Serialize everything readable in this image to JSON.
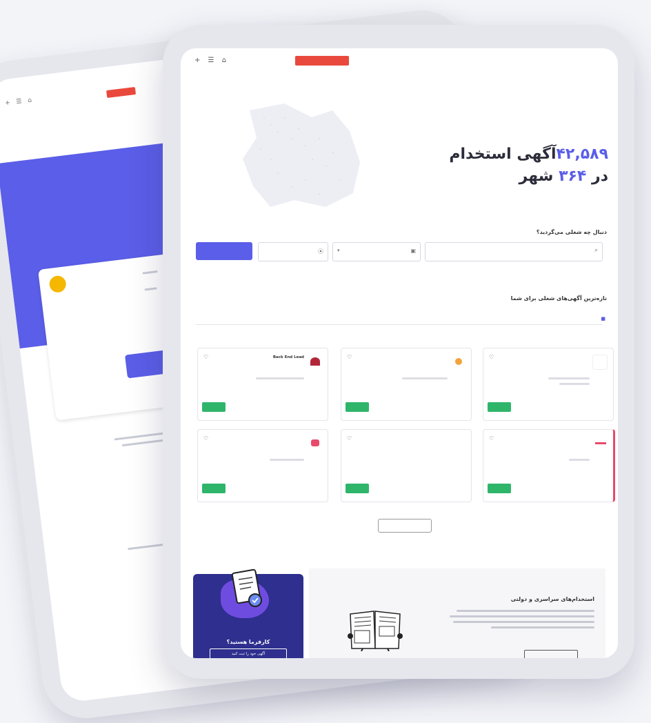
{
  "back_screen": {
    "badge": "",
    "icons": "+ ☰ ⌂",
    "link": "",
    "button": "",
    "side_text_1": "",
    "side_text_2": ""
  },
  "front_screen": {
    "logo": "",
    "nav": {
      "icons": "+ ☰ ⌂",
      "badge": "",
      "items": [
        "",
        "",
        "",
        "",
        "",
        ""
      ]
    },
    "hero": {
      "count": "۴۲,۵۸۹",
      "count_label": "آگهی استخدام",
      "city_prefix": "در",
      "city_count": "۳۶۴",
      "city_label": "شهر"
    },
    "search": {
      "question": "دنبال چه شغلی می‌گردید؟",
      "keyword_placeholder": "",
      "category_placeholder": "",
      "city_placeholder": "",
      "button": ""
    },
    "latest": {
      "title": "تازه‌ترین آگهی‌های شغلی برای شما",
      "suggest_tab": "",
      "suggest_sub": ""
    },
    "jobs": [
      {
        "title": "",
        "company": "",
        "location": "",
        "send": "",
        "logo_color": "#ffffff"
      },
      {
        "title": "",
        "company": "",
        "location": "",
        "send": "",
        "logo_color": "#f2a33a"
      },
      {
        "title": "Back End Lead",
        "company": "",
        "location": "",
        "send": "",
        "logo_color": "#b3263a"
      },
      {
        "title": "",
        "company": "",
        "location": "",
        "send": "",
        "logo_color": "#ffffff"
      },
      {
        "title": "",
        "company": "",
        "location": "",
        "send": "",
        "logo_color": "#ffffff"
      },
      {
        "title": "",
        "company": "",
        "location": "",
        "send": "",
        "logo_color": "#e84a6a"
      }
    ],
    "more_button": "",
    "employer": {
      "title": "کارفرما هستید؟",
      "button": "آگهی خود را ثبت کنید"
    },
    "gov": {
      "title": "استخدام‌های سراسری و دولتی",
      "button": ""
    }
  },
  "colors": {
    "brand": "#5b5ee8",
    "send_button": "#2fb56a",
    "badge": "#e9493c",
    "employer_bg": "#2e2f8e"
  }
}
